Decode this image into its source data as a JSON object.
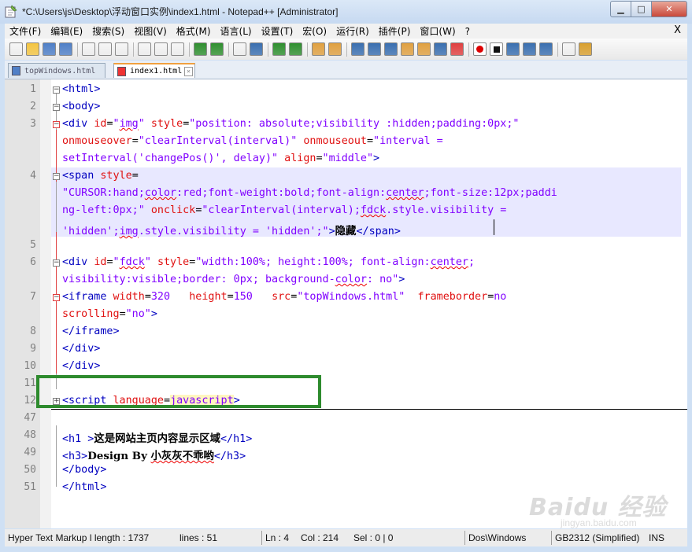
{
  "window": {
    "title": "*C:\\Users\\js\\Desktop\\浮动窗口实例\\index1.html - Notepad++ [Administrator]",
    "min_glyph": "▁",
    "max_glyph": "□",
    "close_glyph": "✕"
  },
  "menu": {
    "items": [
      "文件(F)",
      "编辑(E)",
      "搜索(S)",
      "视图(V)",
      "格式(M)",
      "语言(L)",
      "设置(T)",
      "宏(O)",
      "运行(R)",
      "插件(P)",
      "窗口(W)",
      "?"
    ],
    "close_label": "X"
  },
  "toolbar": {
    "icons": [
      "new-file-icon",
      "open-file-icon",
      "save-icon",
      "save-all-icon",
      "close-file-icon",
      "close-all-icon",
      "print-icon",
      "cut-icon",
      "copy-icon",
      "paste-icon",
      "undo-icon",
      "redo-icon",
      "find-icon",
      "replace-icon",
      "zoom-in-icon",
      "zoom-out-icon",
      "sync-vertical-icon",
      "sync-horizontal-icon",
      "word-wrap-icon",
      "show-all-chars-icon",
      "indent-guide-icon",
      "user-lang-icon",
      "doc-map-icon",
      "function-list-icon",
      "folder-workspace-icon",
      "record-macro-icon",
      "stop-macro-icon",
      "play-macro-icon",
      "run-macro-multiple-icon",
      "save-macro-icon",
      "spell-check-icon",
      "spell-check-options-icon"
    ]
  },
  "tabs": [
    {
      "label": "topWindows.html",
      "active": false
    },
    {
      "label": "index1.html",
      "active": true
    }
  ],
  "tab_close_glyph": "✕",
  "editor": {
    "lines": [
      {
        "num": "1",
        "text": "<html>"
      },
      {
        "num": "2",
        "text": "<body>"
      },
      {
        "num": "3",
        "text": "<div id=\"img\" style=\"position: absolute;visibility :hidden;padding:0px;\""
      },
      {
        "num": "",
        "text": "onmouseover=\"clearInterval(interval)\" onmouseout=\"interval ="
      },
      {
        "num": "",
        "text": "setInterval('changePos()', delay)\" align=\"middle\">"
      },
      {
        "num": "4",
        "text": "<span style="
      },
      {
        "num": "",
        "text": "\"CURSOR:hand;color:red;font-weight:bold;font-align:center;font-size:12px;paddi"
      },
      {
        "num": "",
        "text": "ng-left:0px;\" onclick=\"clearInterval(interval);fdck.style.visibility ="
      },
      {
        "num": "",
        "text": "'hidden';img.style.visibility = 'hidden';\">隐藏</span>"
      },
      {
        "num": "5",
        "text": ""
      },
      {
        "num": "6",
        "text": "<div id=\"fdck\" style=\"width:100%; height:100%; font-align:center;"
      },
      {
        "num": "",
        "text": "visibility:visible;border: 0px; background-color: no\">"
      },
      {
        "num": "7",
        "text": "<iframe width=320   height=150   src=\"topWindows.html\"  frameborder=no"
      },
      {
        "num": "",
        "text": "scrolling=\"no\">"
      },
      {
        "num": "8",
        "text": "</iframe>"
      },
      {
        "num": "9",
        "text": "</div>"
      },
      {
        "num": "10",
        "text": "</div>"
      },
      {
        "num": "11",
        "text": ""
      },
      {
        "num": "12",
        "text": "<script language=javascript>"
      },
      {
        "num": "47",
        "text": ""
      },
      {
        "num": "48",
        "text": "<h1 >这是网站主页内容显示区域</h1>"
      },
      {
        "num": "49",
        "text": "<h3>Design By 小灰灰不乖哟</h3>"
      },
      {
        "num": "50",
        "text": "</body>"
      },
      {
        "num": "51",
        "text": "</html>"
      }
    ]
  },
  "statusbar": {
    "file_type": "Hyper Text Markup l length : 1737",
    "lines": "lines : 51",
    "ln": "Ln : 4",
    "col": "Col : 214",
    "sel": "Sel : 0 | 0",
    "eol": "Dos\\Windows",
    "encoding": "GB2312 (Simplified)",
    "mode": "INS"
  },
  "watermark": {
    "main": "Baidu 经验",
    "sub": "jingyan.baidu.com"
  },
  "colors": {
    "tag": "#0000c0",
    "attribute": "#e01010",
    "value": "#8000ff",
    "highlight": "#e8e8ff",
    "annotation_box": "#2e8b2e"
  }
}
